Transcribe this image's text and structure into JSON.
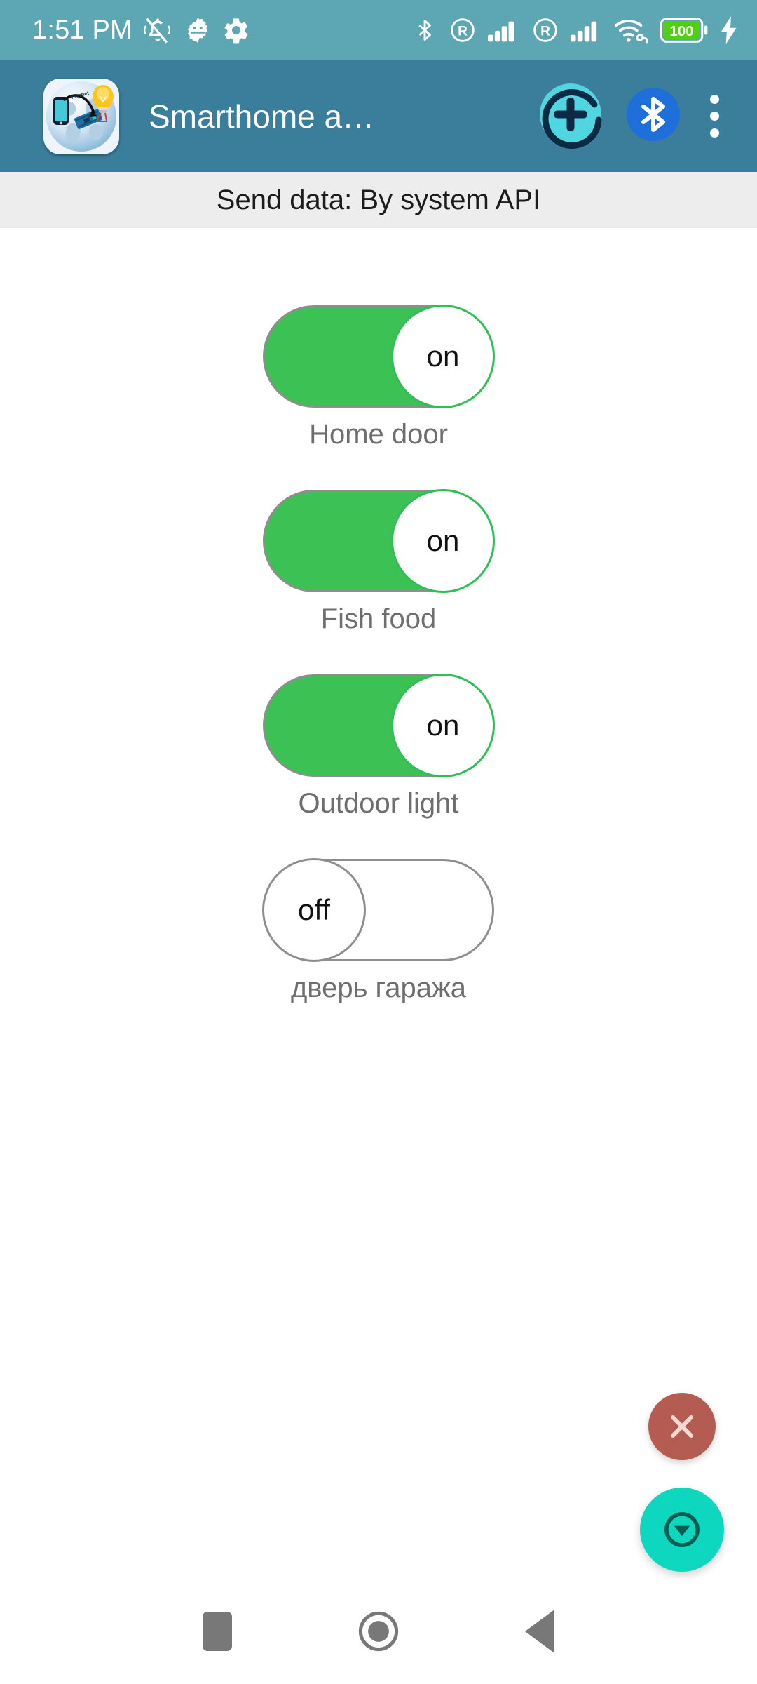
{
  "status_bar": {
    "time": "1:51 PM",
    "left_icons": [
      "bell-muted-icon",
      "android-debug-icon",
      "gear-icon"
    ],
    "right_icons": [
      "bluetooth-icon",
      "roaming-icon",
      "signal-bars-icon",
      "roaming-icon",
      "signal-bars-icon",
      "wifi-link-icon",
      "battery-icon",
      "charging-bolt-icon"
    ],
    "battery_level": "100",
    "background_color": "#5da7b4"
  },
  "app_bar": {
    "title": "Smarthome a…",
    "icon_name": "smarthome-app-icon",
    "add_button_label": "+",
    "add_button_name": "add-device-button",
    "bluetooth_button_name": "bluetooth-button",
    "overflow_menu_name": "overflow-menu-button",
    "background_color": "#3a7e9c",
    "add_button_color": "#4fd6e0",
    "bluetooth_button_color": "#1f6fdb"
  },
  "subtitle": {
    "text": "Send data: By system API",
    "background_color": "#ededed"
  },
  "toggles": [
    {
      "label": "Home door",
      "state_text": "on",
      "state": "on"
    },
    {
      "label": "Fish food",
      "state_text": "on",
      "state": "on"
    },
    {
      "label": "Outdoor light",
      "state_text": "on",
      "state": "on"
    },
    {
      "label": "дверь гаража",
      "state_text": "off",
      "state": "off"
    }
  ],
  "colors": {
    "toggle_on_green": "#3cc154",
    "toggle_border_gray": "#8e8e8e",
    "label_gray": "#6e6e6e"
  },
  "fabs": {
    "close": {
      "name": "close-fab",
      "icon": "close-x-icon",
      "color": "#b55c52"
    },
    "main": {
      "name": "collapse-fab",
      "icon": "chevron-down-circle-icon",
      "color": "#0ed7bf"
    }
  },
  "nav_bar": {
    "recents_label": "recents-button",
    "home_label": "home-button",
    "back_label": "back-button",
    "icon_color": "#787878"
  }
}
